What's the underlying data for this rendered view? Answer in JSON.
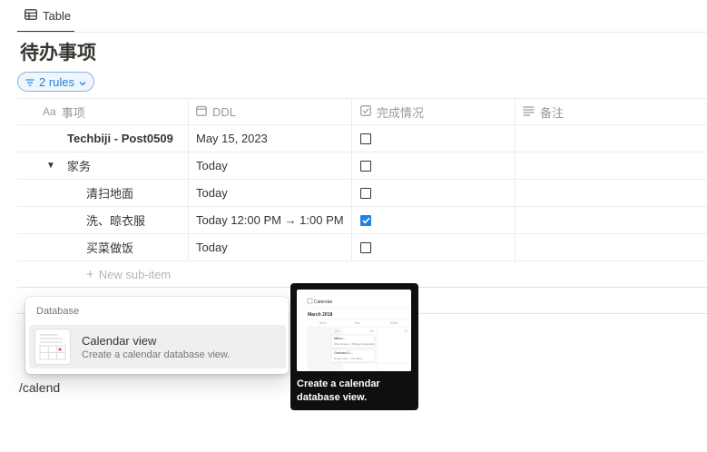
{
  "tab": {
    "label": "Table",
    "icon": "table-icon"
  },
  "page_title": "待办事项",
  "filter": {
    "label": "2 rules"
  },
  "columns": [
    {
      "label": "事项",
      "prefix": "Aa",
      "icon": "text-property-icon"
    },
    {
      "label": "DDL",
      "icon": "calendar-property-icon"
    },
    {
      "label": "完成情况",
      "icon": "checkbox-property-icon"
    },
    {
      "label": "备注",
      "icon": "text-lines-icon"
    }
  ],
  "rows": [
    {
      "name": "Techbiji - Post0509",
      "ddl": "May 15, 2023",
      "done": false,
      "bold": true,
      "indent": 0,
      "toggle": false
    },
    {
      "name": "家务",
      "ddl": "Today",
      "done": false,
      "bold": false,
      "indent": 0,
      "toggle": true
    },
    {
      "name": "清扫地面",
      "ddl": "Today",
      "done": false,
      "bold": false,
      "indent": 1,
      "toggle": false
    },
    {
      "name": "洗、晾衣服",
      "ddl": "Today 12:00 PM → 1:00 PM",
      "done": true,
      "bold": false,
      "indent": 1,
      "toggle": false
    },
    {
      "name": "买菜做饭",
      "ddl": "Today",
      "done": false,
      "bold": false,
      "indent": 1,
      "toggle": false
    }
  ],
  "new_sub_item": "New sub-item",
  "command_menu": {
    "section": "Database",
    "item": {
      "title": "Calendar view",
      "description": "Create a calendar database view."
    }
  },
  "command_text": "/calend",
  "preview": {
    "caption": "Create a calendar database view.",
    "mock": {
      "header": "Calendar",
      "month": "March 2018",
      "days": [
        "Mon",
        "Tue",
        "Wed"
      ],
      "dates": [
        "25",
        "26",
        "27"
      ],
      "cards": [
        {
          "title": "Menu...",
          "line": "Chet Graves · Bridges Gorgaders"
        },
        {
          "title": "Onboard 1...",
          "line": "Grace Lustt · Ivan Zhao"
        }
      ]
    }
  },
  "colors": {
    "accent": "#2383e2",
    "text": "#37352f",
    "muted": "#9b9a97"
  }
}
